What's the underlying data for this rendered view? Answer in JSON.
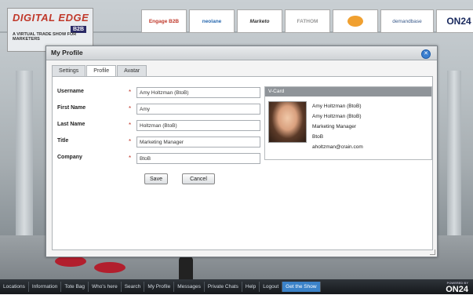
{
  "branding": {
    "title": "DIGITAL EDGE",
    "badge": "B2B",
    "subtitle": "A VIRTUAL TRADE SHOW FOR MARKETERS"
  },
  "sponsors": [
    "Engage B2B",
    "neolane",
    "Marketo",
    "FATHOM",
    "",
    "demandbase",
    "ON24"
  ],
  "dialog": {
    "title": "My Profile",
    "tabs": [
      "Settings",
      "Profile",
      "Avatar"
    ],
    "active_tab": "Profile",
    "fields": [
      {
        "label": "Username",
        "value": "Amy Holtzman (BtoB)"
      },
      {
        "label": "First Name",
        "value": "Amy"
      },
      {
        "label": "Last Name",
        "value": "Holtzman (BtoB)"
      },
      {
        "label": "Title",
        "value": "Marketing Manager"
      },
      {
        "label": "Company",
        "value": "BtoB"
      }
    ],
    "required_mark": "*",
    "save_label": "Save",
    "cancel_label": "Cancel",
    "vcard": {
      "title": "V-Card",
      "lines": [
        "Amy Holtzman (BtoB)",
        "Amy Holtzman (BtoB)",
        "Marketing Manager",
        "BtoB",
        "aholtzman@crain.com"
      ]
    }
  },
  "bottom_nav": {
    "items": [
      "Locations",
      "Information",
      "Tote Bag",
      "Who's here",
      "Search",
      "My Profile",
      "Messages",
      "Private Chats",
      "Help",
      "Logout",
      "Get the Show"
    ],
    "powered_by": "POWERED BY",
    "brand": "ON24"
  },
  "colors": {
    "accent": "#3b82c8",
    "required": "#c0392b",
    "bottombar": "#1e2226"
  }
}
